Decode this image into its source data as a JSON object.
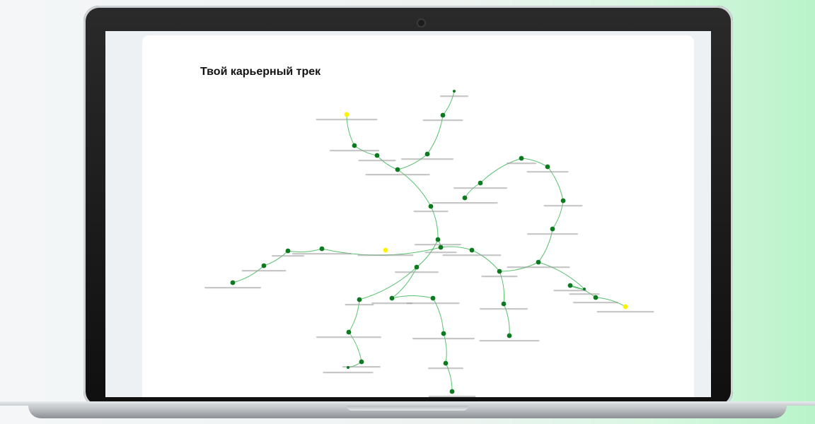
{
  "screen": {
    "title": "Твой карьерный трек"
  },
  "colors": {
    "node": "#0c7a1e",
    "edge": "#2eb24a",
    "highlight": "#fff200",
    "label": "#9a9a9a"
  }
}
